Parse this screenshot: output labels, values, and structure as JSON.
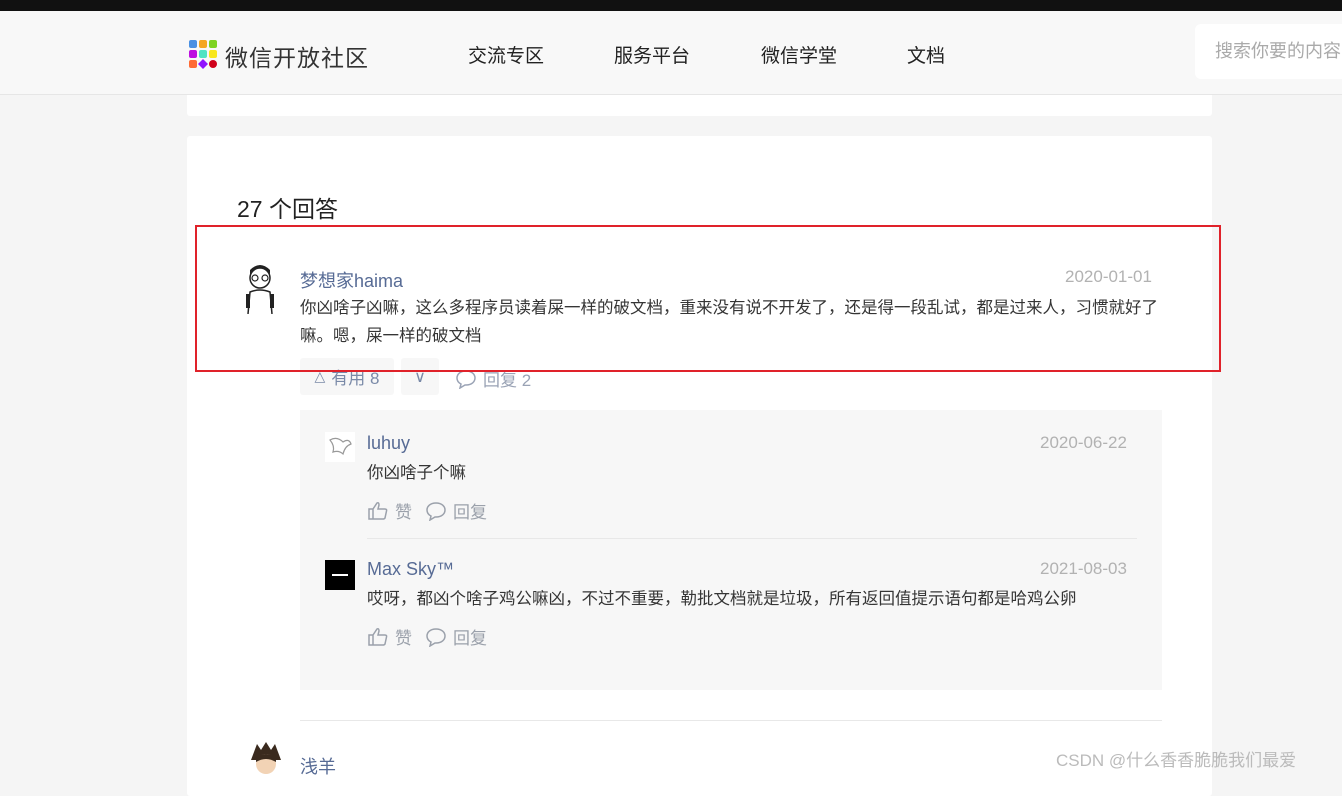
{
  "navbar": {
    "brand": "微信开放社区",
    "items": [
      "交流专区",
      "服务平台",
      "微信学堂",
      "文档"
    ],
    "search_placeholder": "搜索你要的内容"
  },
  "answers": {
    "count_label": "27 个回答",
    "first": {
      "username": "梦想家haima",
      "date": "2020-01-01",
      "content": "你凶啥子凶嘛，这么多程序员读着屎一样的破文档，重来没有说不开发了，还是得一段乱试，都是过来人，习惯就好了嘛。嗯，屎一样的破文档",
      "useful_label": "有用 8",
      "reply_label": "回复 2"
    },
    "replies": [
      {
        "username": "luhuy",
        "date": "2020-06-22",
        "content": "你凶啥子个嘛",
        "like": "赞",
        "reply": "回复"
      },
      {
        "username": "Max Sky™",
        "date": "2021-08-03",
        "content": "哎呀，都凶个啥子鸡公嘛凶，不过不重要，勒批文档就是垃圾，所有返回值提示语句都是哈鸡公卵",
        "like": "赞",
        "reply": "回复"
      }
    ],
    "next_username": "浅羊"
  },
  "watermark": "CSDN @什么香香脆脆我们最爱",
  "colors": {
    "link": "#576b95",
    "highlight_border": "#e0222a"
  }
}
